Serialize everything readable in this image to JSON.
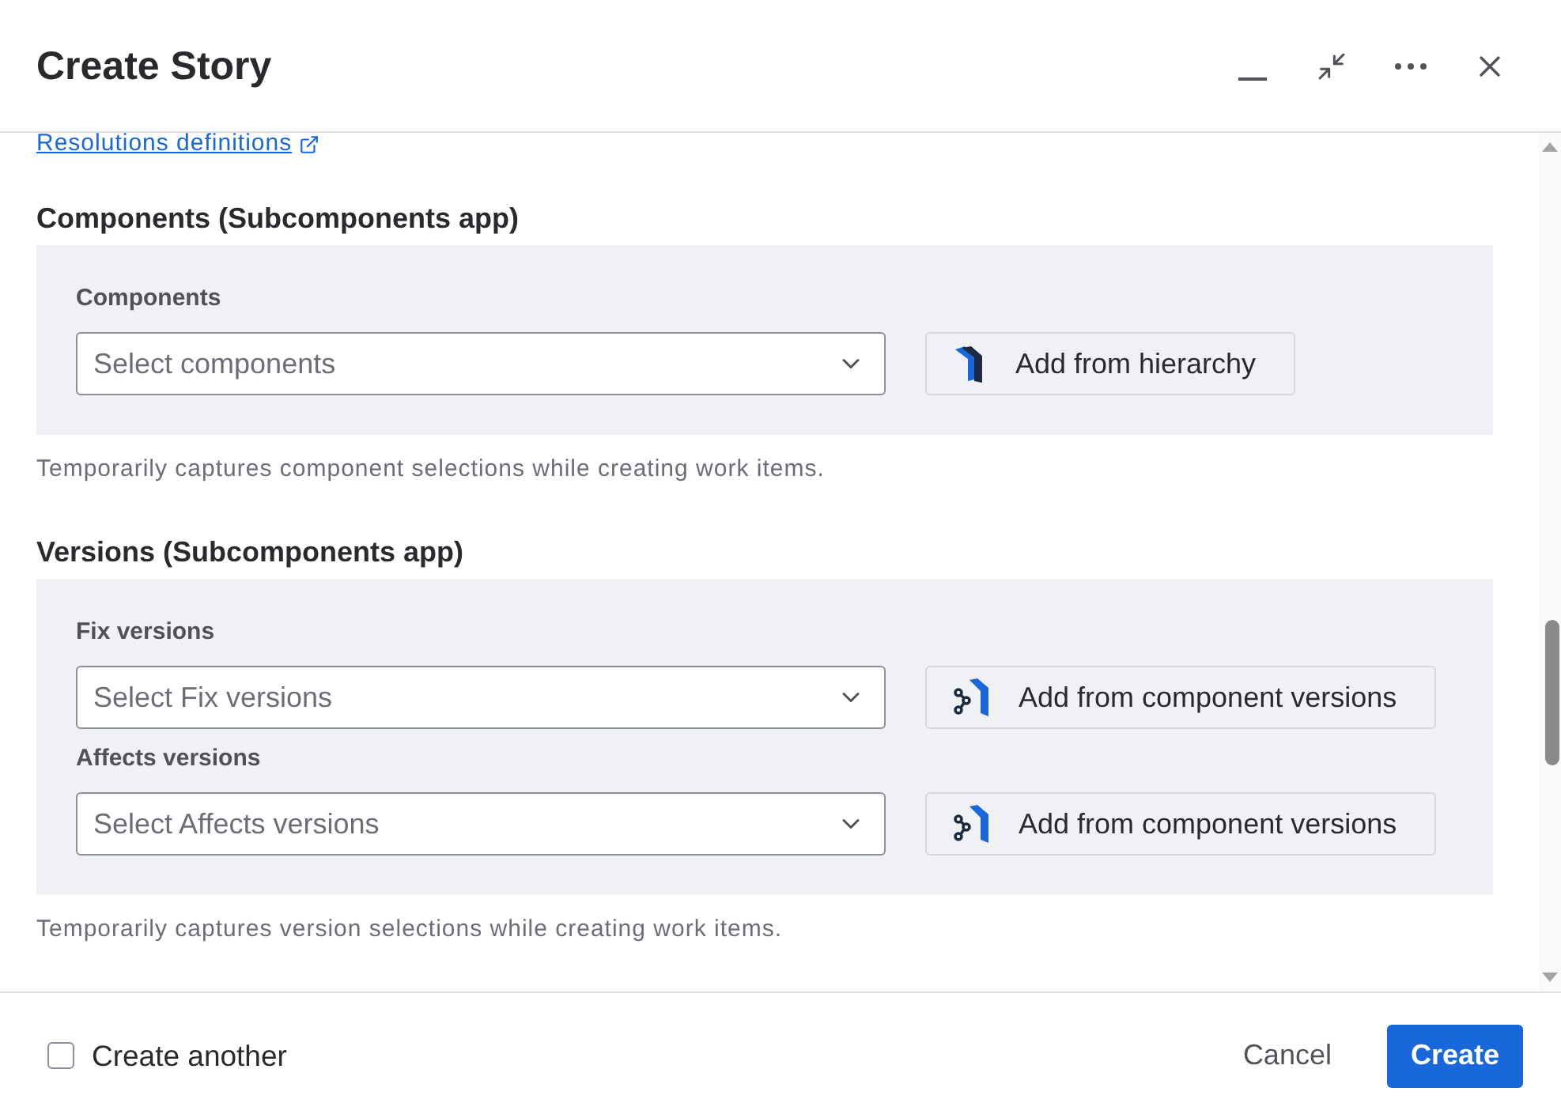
{
  "dialog": {
    "title": "Create Story"
  },
  "link": {
    "text": "Resolutions definitions"
  },
  "sections": [
    {
      "heading": "Components (Subcomponents app)",
      "fields": [
        {
          "label": "Components",
          "placeholder": "Select components",
          "action": "Add from hierarchy",
          "kind": "hierarchy"
        }
      ],
      "helper": "Temporarily captures component selections while creating work items."
    },
    {
      "heading": "Versions (Subcomponents app)",
      "fields": [
        {
          "label": "Fix versions",
          "placeholder": "Select Fix versions",
          "action": "Add from component versions",
          "kind": "versions"
        },
        {
          "label": "Affects versions",
          "placeholder": "Select Affects versions",
          "action": "Add from component versions",
          "kind": "versions"
        }
      ],
      "helper": "Temporarily captures version selections while creating work items."
    }
  ],
  "footer": {
    "create_another": {
      "label": "Create another",
      "checked": false
    },
    "cancel": "Cancel",
    "create": "Create"
  }
}
